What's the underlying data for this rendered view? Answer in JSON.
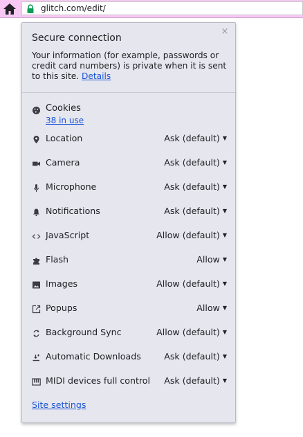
{
  "browser": {
    "url": "glitch.com/edit/",
    "home_icon": "home-icon",
    "lock_icon": "lock-icon"
  },
  "popup": {
    "close_glyph": "×",
    "title": "Secure connection",
    "description": "Your information (for example, passwords or credit card numbers) is private when it is sent to this site.",
    "details_link": "Details",
    "cookies": {
      "label": "Cookies",
      "in_use": "38 in use",
      "icon": "cookie-icon"
    },
    "permissions": [
      {
        "label": "Location",
        "value": "Ask (default)",
        "icon": "location-pin-icon"
      },
      {
        "label": "Camera",
        "value": "Ask (default)",
        "icon": "camera-icon"
      },
      {
        "label": "Microphone",
        "value": "Ask (default)",
        "icon": "microphone-icon"
      },
      {
        "label": "Notifications",
        "value": "Ask (default)",
        "icon": "bell-icon"
      },
      {
        "label": "JavaScript",
        "value": "Allow (default)",
        "icon": "code-icon"
      },
      {
        "label": "Flash",
        "value": "Allow",
        "icon": "puzzle-icon"
      },
      {
        "label": "Images",
        "value": "Allow (default)",
        "icon": "image-icon"
      },
      {
        "label": "Popups",
        "value": "Allow",
        "icon": "popup-icon"
      },
      {
        "label": "Background Sync",
        "value": "Allow (default)",
        "icon": "sync-icon"
      },
      {
        "label": "Automatic Downloads",
        "value": "Ask (default)",
        "icon": "download-icon"
      },
      {
        "label": "MIDI devices full control",
        "value": "Ask (default)",
        "icon": "midi-icon"
      }
    ],
    "site_settings_link": "Site settings"
  },
  "colors": {
    "topbar": "#f6c8f3",
    "popup_bg": "#e6e6ee",
    "link": "#1a55d6",
    "lock_green": "#0f9d58"
  }
}
